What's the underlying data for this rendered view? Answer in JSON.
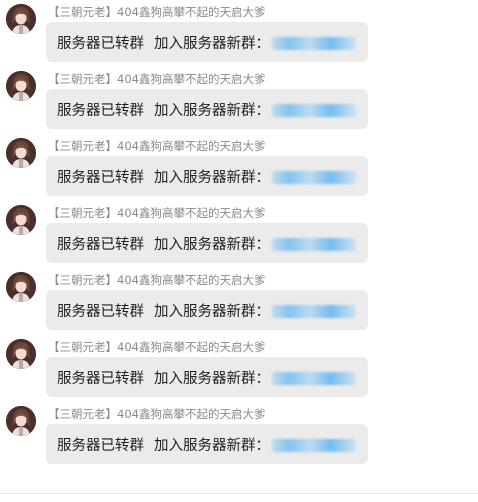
{
  "chat": {
    "messages": [
      {
        "sender": "【三朝元老】404鑫狗高攀不起的天启大爹",
        "text_prefix": "服务器已转群",
        "text_label": "加入服务器新群："
      },
      {
        "sender": "【三朝元老】404鑫狗高攀不起的天启大爹",
        "text_prefix": "服务器已转群",
        "text_label": "加入服务器新群："
      },
      {
        "sender": "【三朝元老】404鑫狗高攀不起的天启大爹",
        "text_prefix": "服务器已转群",
        "text_label": "加入服务器新群："
      },
      {
        "sender": "【三朝元老】404鑫狗高攀不起的天启大爹",
        "text_prefix": "服务器已转群",
        "text_label": "加入服务器新群："
      },
      {
        "sender": "【三朝元老】404鑫狗高攀不起的天启大爹",
        "text_prefix": "服务器已转群",
        "text_label": "加入服务器新群："
      },
      {
        "sender": "【三朝元老】404鑫狗高攀不起的天启大爹",
        "text_prefix": "服务器已转群",
        "text_label": "加入服务器新群："
      },
      {
        "sender": "【三朝元老】404鑫狗高攀不起的天启大爹",
        "text_prefix": "服务器已转群",
        "text_label": "加入服务器新群："
      }
    ]
  },
  "colors": {
    "bubble_bg": "#ebebeb",
    "sender_text": "#8a8a8a",
    "message_text": "#1f1f1f",
    "redacted_link": "#78bef0"
  },
  "icons": {
    "avatar": "user-avatar-icon",
    "redacted": "redacted-link"
  }
}
